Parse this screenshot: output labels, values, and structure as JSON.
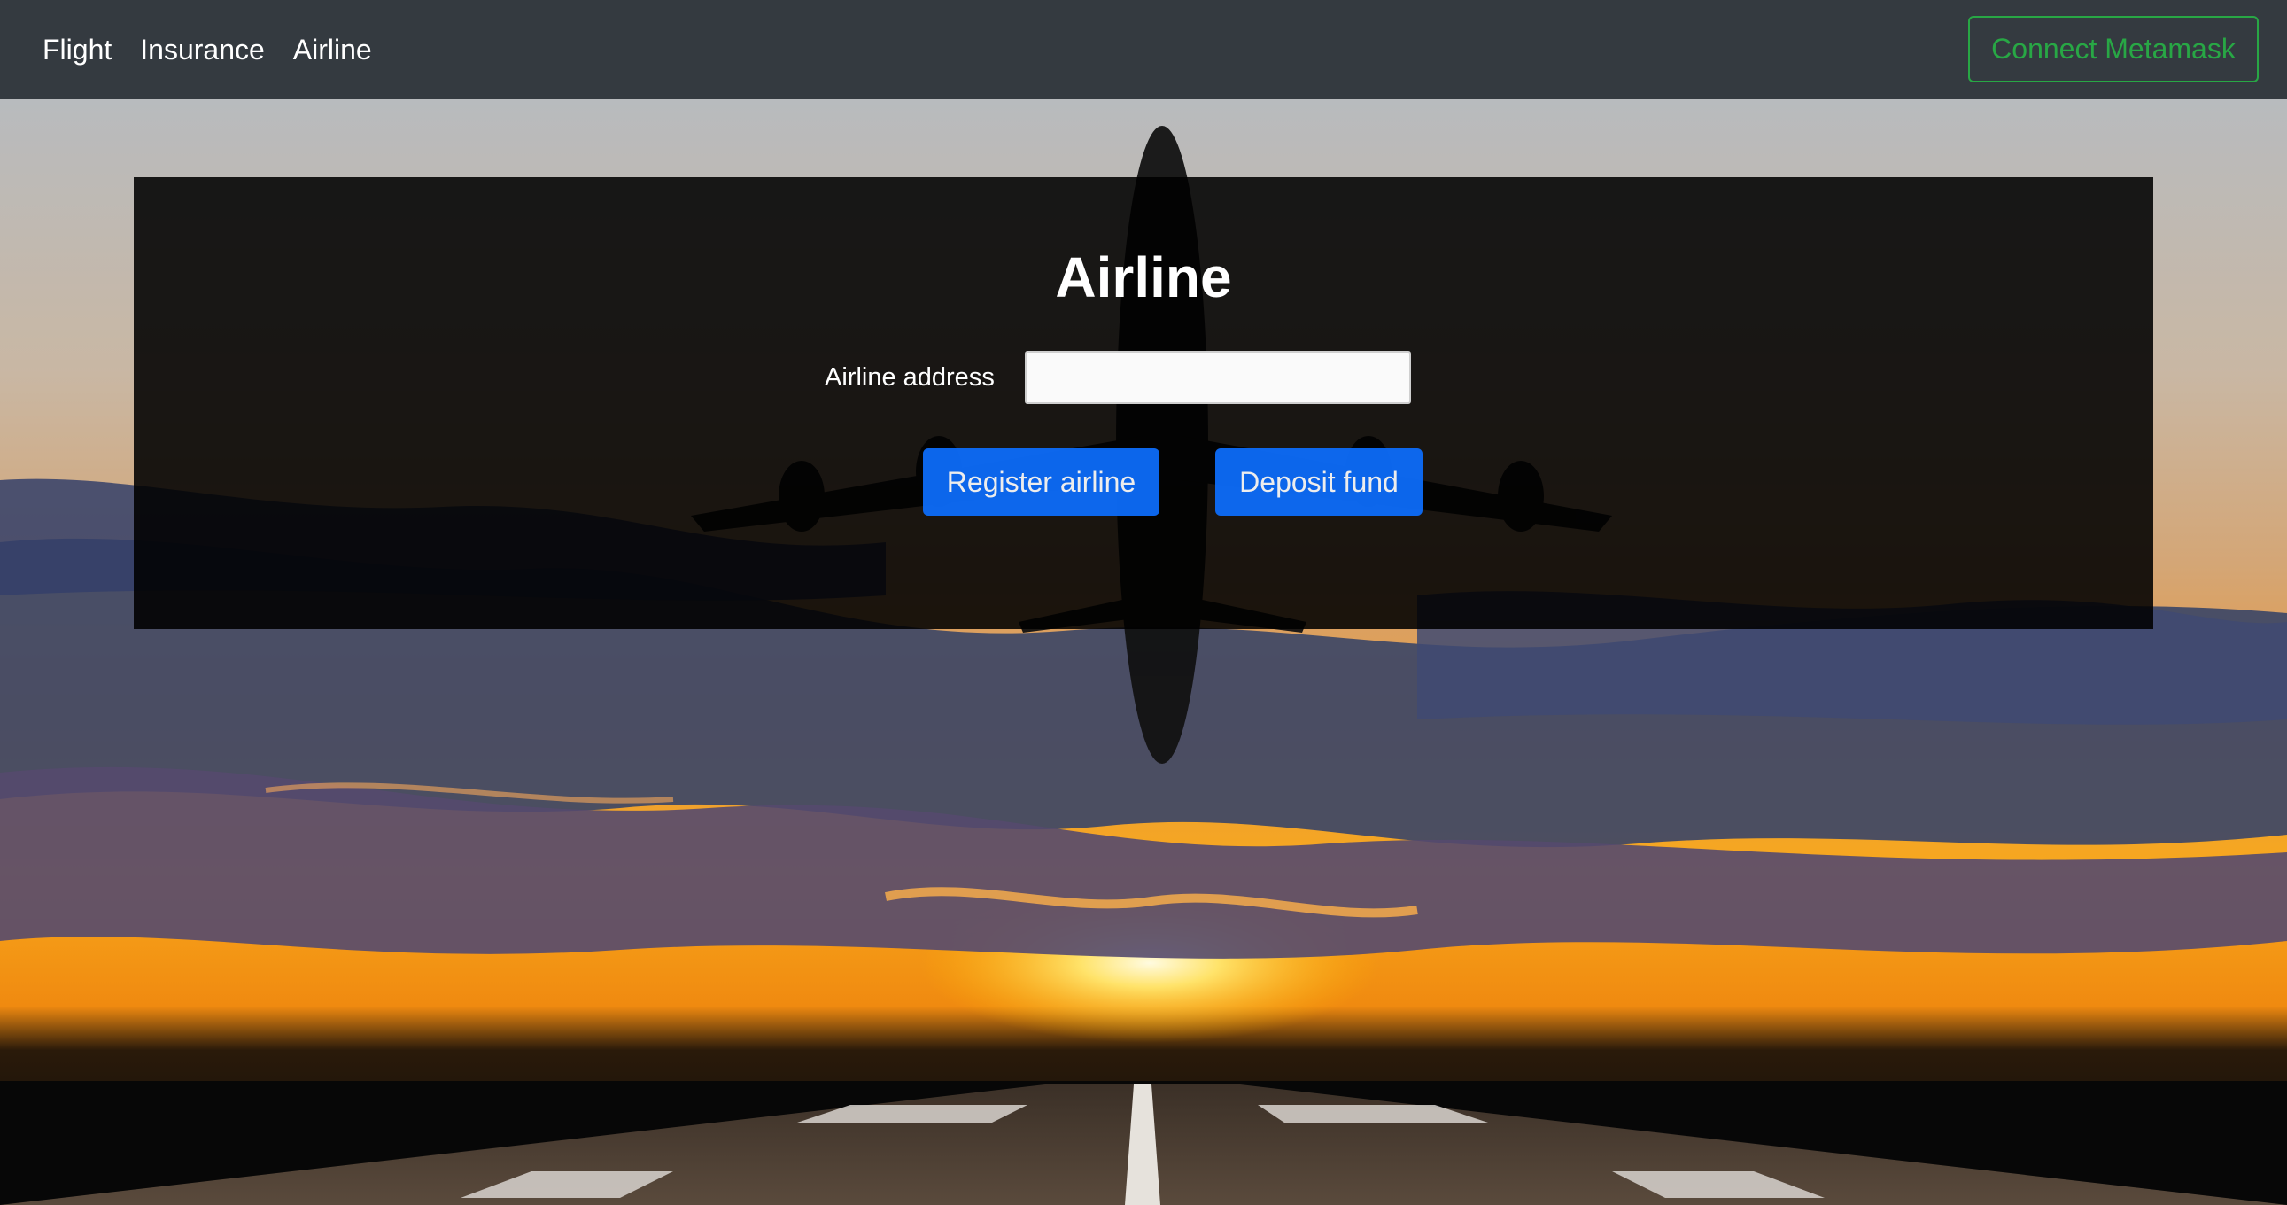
{
  "navbar": {
    "links": [
      {
        "label": "Flight"
      },
      {
        "label": "Insurance"
      },
      {
        "label": "Airline"
      }
    ],
    "connect_label": "Connect Metamask"
  },
  "card": {
    "title": "Airline",
    "address_label": "Airline address",
    "address_value": "",
    "register_label": "Register airline",
    "deposit_label": "Deposit fund"
  },
  "colors": {
    "navbar_bg": "#343a40",
    "success": "#28a745",
    "primary": "#0d6efd",
    "sunset_orange": "#f59a14",
    "sky_top": "#b9bcbd"
  }
}
